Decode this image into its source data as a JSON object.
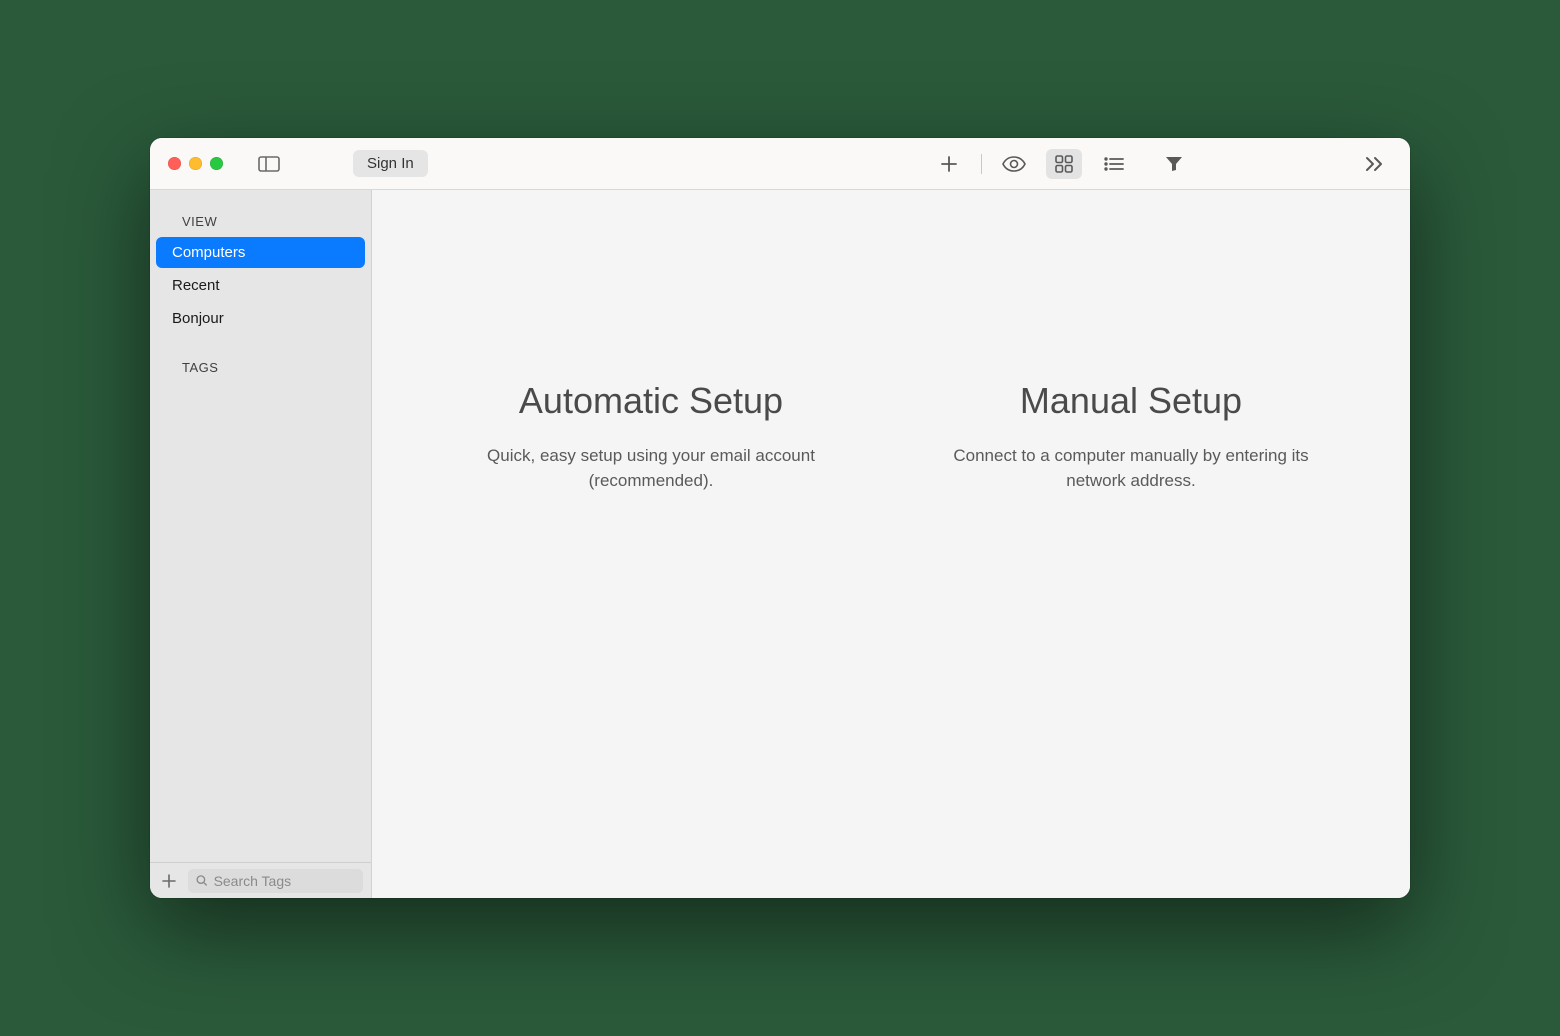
{
  "toolbar": {
    "sign_in_label": "Sign In"
  },
  "sidebar": {
    "sections": [
      {
        "header": "VIEW",
        "items": [
          {
            "label": "Computers",
            "selected": true
          },
          {
            "label": "Recent",
            "selected": false
          },
          {
            "label": "Bonjour",
            "selected": false
          }
        ]
      },
      {
        "header": "TAGS",
        "items": []
      }
    ],
    "search_placeholder": "Search Tags"
  },
  "main": {
    "options": [
      {
        "title": "Automatic Setup",
        "description": "Quick, easy setup using your email account (recommended)."
      },
      {
        "title": "Manual Setup",
        "description": "Connect to a computer manually by entering its network address."
      }
    ]
  }
}
